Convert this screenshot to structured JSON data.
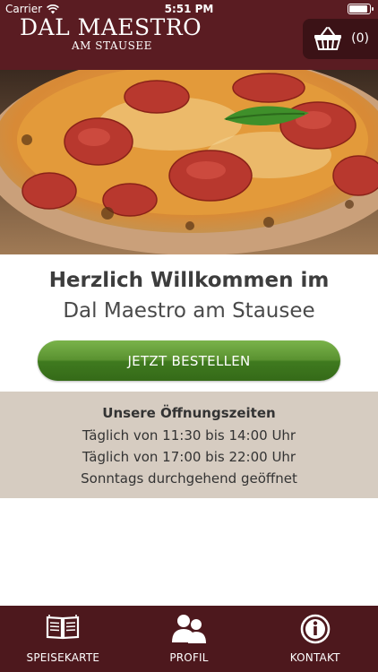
{
  "status_bar": {
    "carrier": "Carrier",
    "time": "5:51 PM"
  },
  "header": {
    "logo_main": "DAL MAESTRO",
    "logo_sub": "AM STAUSEE",
    "cart_count": "(0)",
    "cart_icon": "basket-icon"
  },
  "hero": {
    "image": "pizza-photo"
  },
  "welcome": {
    "line1": "Herzlich Willkommen im",
    "line2": "Dal Maestro am Stausee",
    "order_button": "JETZT BESTELLEN"
  },
  "hours": {
    "title": "Unsere Öffnungszeiten",
    "rows": [
      "Täglich von 11:30 bis 14:00 Uhr",
      "Täglich von 17:00 bis 22:00 Uhr",
      "Sonntags durchgehend geöffnet"
    ]
  },
  "tabs": [
    {
      "label": "SPEISEKARTE",
      "icon": "book-icon"
    },
    {
      "label": "PROFIL",
      "icon": "profile-icon"
    },
    {
      "label": "KONTAKT",
      "icon": "info-icon"
    }
  ],
  "colors": {
    "header_bg": "#5a1c22",
    "tabbar_bg": "#4d181d",
    "button_green": "#4f8a2a",
    "hours_bg": "#d6ccc1"
  }
}
